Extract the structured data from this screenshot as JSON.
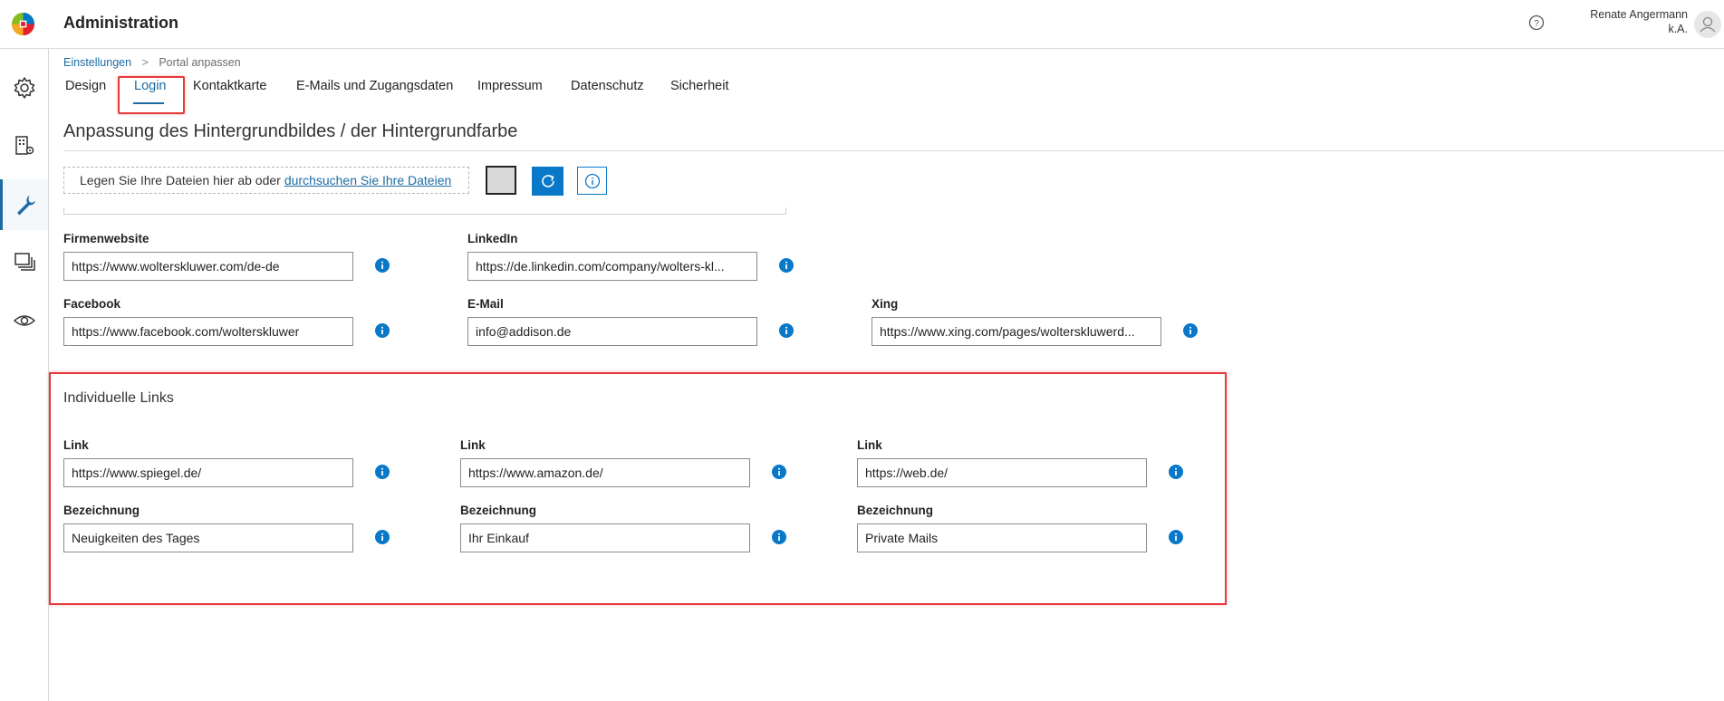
{
  "header": {
    "title": "Administration",
    "user_name": "Renate Angermann",
    "user_role": "k.A."
  },
  "sidebar": {
    "items": [
      {
        "icon": "gear-icon"
      },
      {
        "icon": "building-settings-icon"
      },
      {
        "icon": "wrench-icon",
        "active": true
      },
      {
        "icon": "documents-icon"
      },
      {
        "icon": "eye-icon"
      }
    ]
  },
  "breadcrumb": {
    "parent": "Einstellungen",
    "current": "Portal anpassen"
  },
  "tabs": [
    {
      "label": "Design"
    },
    {
      "label": "Login",
      "active": true
    },
    {
      "label": "Kontaktkarte"
    },
    {
      "label": "E-Mails und Zugangsdaten"
    },
    {
      "label": "Impressum"
    },
    {
      "label": "Datenschutz"
    },
    {
      "label": "Sicherheit"
    }
  ],
  "background": {
    "title": "Anpassung des Hintergrundbildes / der Hintergrundfarbe",
    "drop_text": "Legen Sie Ihre Dateien hier ab oder",
    "browse_link": "durchsuchen Sie Ihre Dateien",
    "swatch_color": "#d9d9d9"
  },
  "social": {
    "firmenwebsite": {
      "label": "Firmenwebsite",
      "value": "https://www.wolterskluwer.com/de-de"
    },
    "linkedin": {
      "label": "LinkedIn",
      "value": "https://de.linkedin.com/company/wolters-kl..."
    },
    "facebook": {
      "label": "Facebook",
      "value": "https://www.facebook.com/wolterskluwer"
    },
    "email": {
      "label": "E-Mail",
      "value": "info@addison.de"
    },
    "xing": {
      "label": "Xing",
      "value": "https://www.xing.com/pages/wolterskluwerd..."
    }
  },
  "individual_links": {
    "title": "Individuelle Links",
    "link_label": "Link",
    "name_label": "Bezeichnung",
    "items": [
      {
        "url": "https://www.spiegel.de/",
        "name": "Neuigkeiten des Tages"
      },
      {
        "url": "https://www.amazon.de/",
        "name": "Ihr Einkauf"
      },
      {
        "url": "https://web.de/",
        "name": "Private Mails"
      }
    ]
  },
  "colors": {
    "accent": "#1c6ba3",
    "info_blue": "#0a78c8",
    "highlight_red": "#e5383c"
  }
}
